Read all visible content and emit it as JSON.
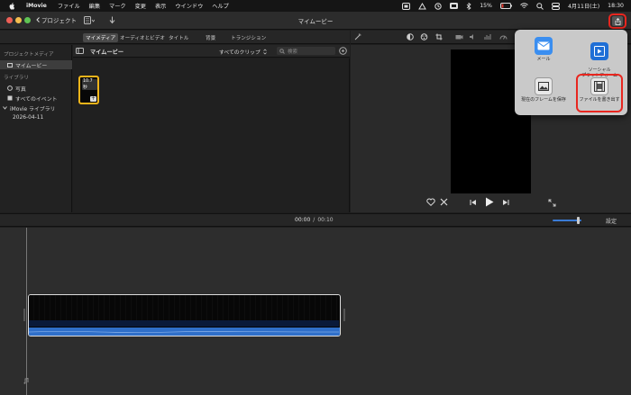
{
  "menubar": {
    "app_name": "iMovie",
    "items": [
      "ファイル",
      "編集",
      "マーク",
      "変更",
      "表示",
      "ウインドウ",
      "ヘルプ"
    ],
    "battery": "15%",
    "date": "4月11日(土)",
    "time": "18:30"
  },
  "toolbar": {
    "back_label": "プロジェクト",
    "title": "マイムービー"
  },
  "tabs": [
    {
      "label": "マイメディア"
    },
    {
      "label": "オーディオとビデオ"
    },
    {
      "label": "タイトル"
    },
    {
      "label": "背景"
    },
    {
      "label": "トランジション"
    }
  ],
  "sidebar": {
    "section_media": "プロジェクトメディア",
    "project_item": "マイムービー",
    "section_library": "ライブラリ",
    "photos": "写真",
    "all_events": "すべてのイベント",
    "library_name": "iMovie ライブラリ",
    "event_date": "2026-04-11"
  },
  "browser": {
    "title": "マイムービー",
    "filter": "すべてのクリップ",
    "search_placeholder": "検索",
    "clip_duration": "10.7秒"
  },
  "share_menu": {
    "items": [
      {
        "label": "メール",
        "icon": "mail-icon"
      },
      {
        "label": "ソーシャル\nプラットフォーム",
        "icon": "social-platform-icon"
      },
      {
        "label": "現在のフレームを保存",
        "icon": "save-frame-icon"
      },
      {
        "label": "ファイルを書き出す",
        "icon": "export-file-icon"
      }
    ]
  },
  "timeline": {
    "current_time": "00:00",
    "separator": "/",
    "total_time": "00:10",
    "settings_label": "設定"
  },
  "colors": {
    "highlight": "#e8261f",
    "clip_border": "#f2b51a",
    "audio": "#2f6fc9"
  }
}
